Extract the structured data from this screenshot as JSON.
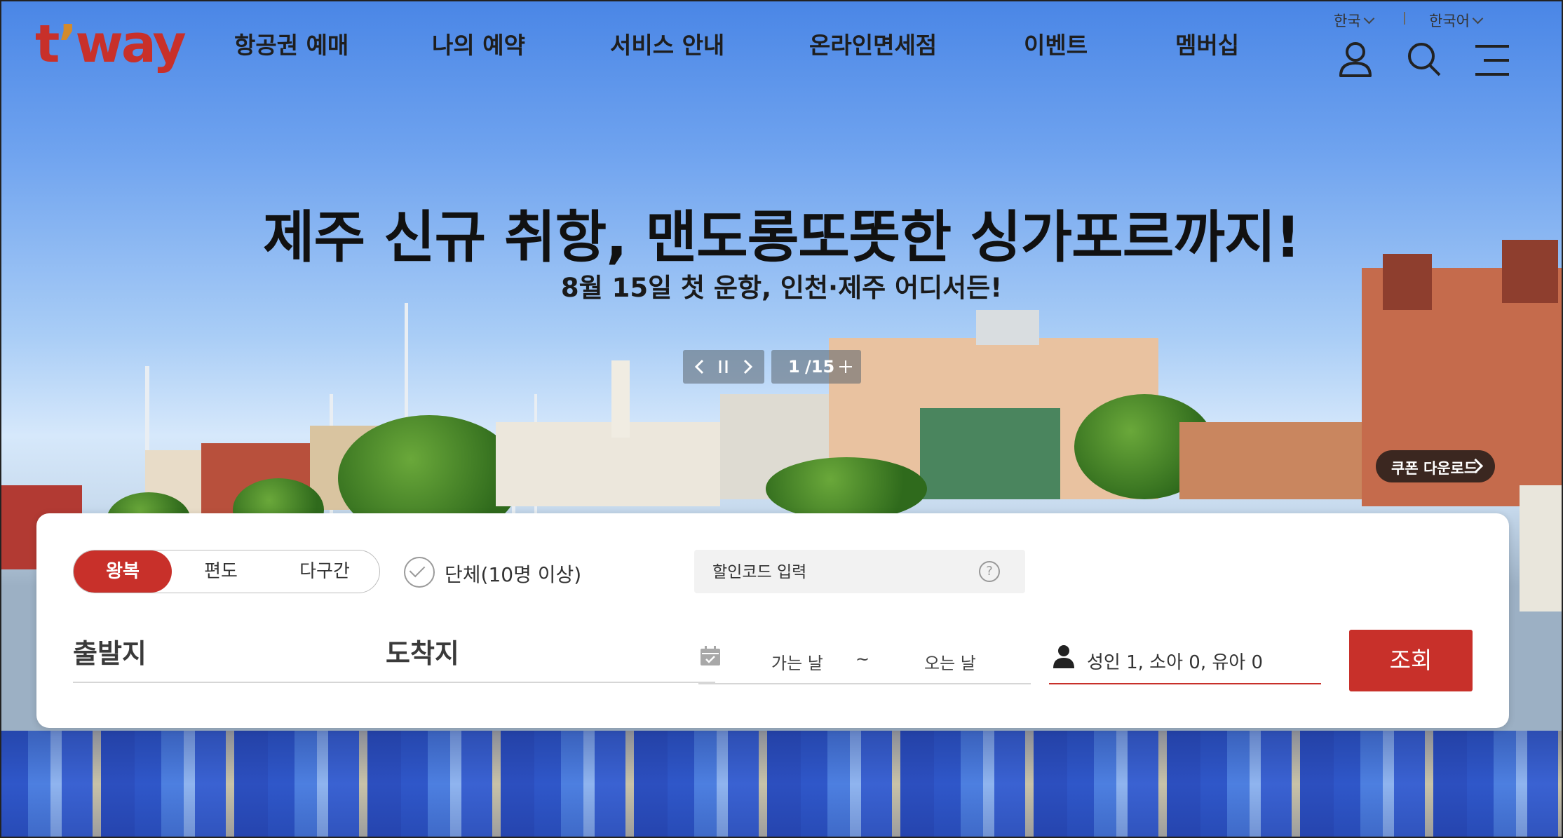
{
  "brand": {
    "logo_text": "t'way",
    "accent_color": "#c8302a"
  },
  "nav": {
    "items": [
      "항공권 예매",
      "나의 예약",
      "서비스 안내",
      "온라인면세점",
      "이벤트",
      "멤버십"
    ]
  },
  "utility": {
    "region": "한국",
    "language": "한국어"
  },
  "header_icons": [
    "user-icon",
    "search-icon",
    "menu-icon"
  ],
  "banner": {
    "headline": "제주 신규 취항, 맨도롱또똣한 싱가포르까지!",
    "subline": "8월 15일 첫 운항, 인천·제주 어디서든!",
    "current_slide": "1",
    "total_slides": "/15",
    "coupon_label": "쿠폰 다운로드"
  },
  "booking": {
    "trip_types": [
      "왕복",
      "편도",
      "다구간"
    ],
    "selected_trip_type": "왕복",
    "group_label": "단체(10명 이상)",
    "promo_placeholder": "할인코드 입력",
    "origin_placeholder": "출발지",
    "destination_placeholder": "도착지",
    "depart_label": "가는 날",
    "date_separator": "~",
    "return_label": "오는 날",
    "passengers": "성인 1, 소아 0, 유아 0",
    "search_label": "조회"
  }
}
